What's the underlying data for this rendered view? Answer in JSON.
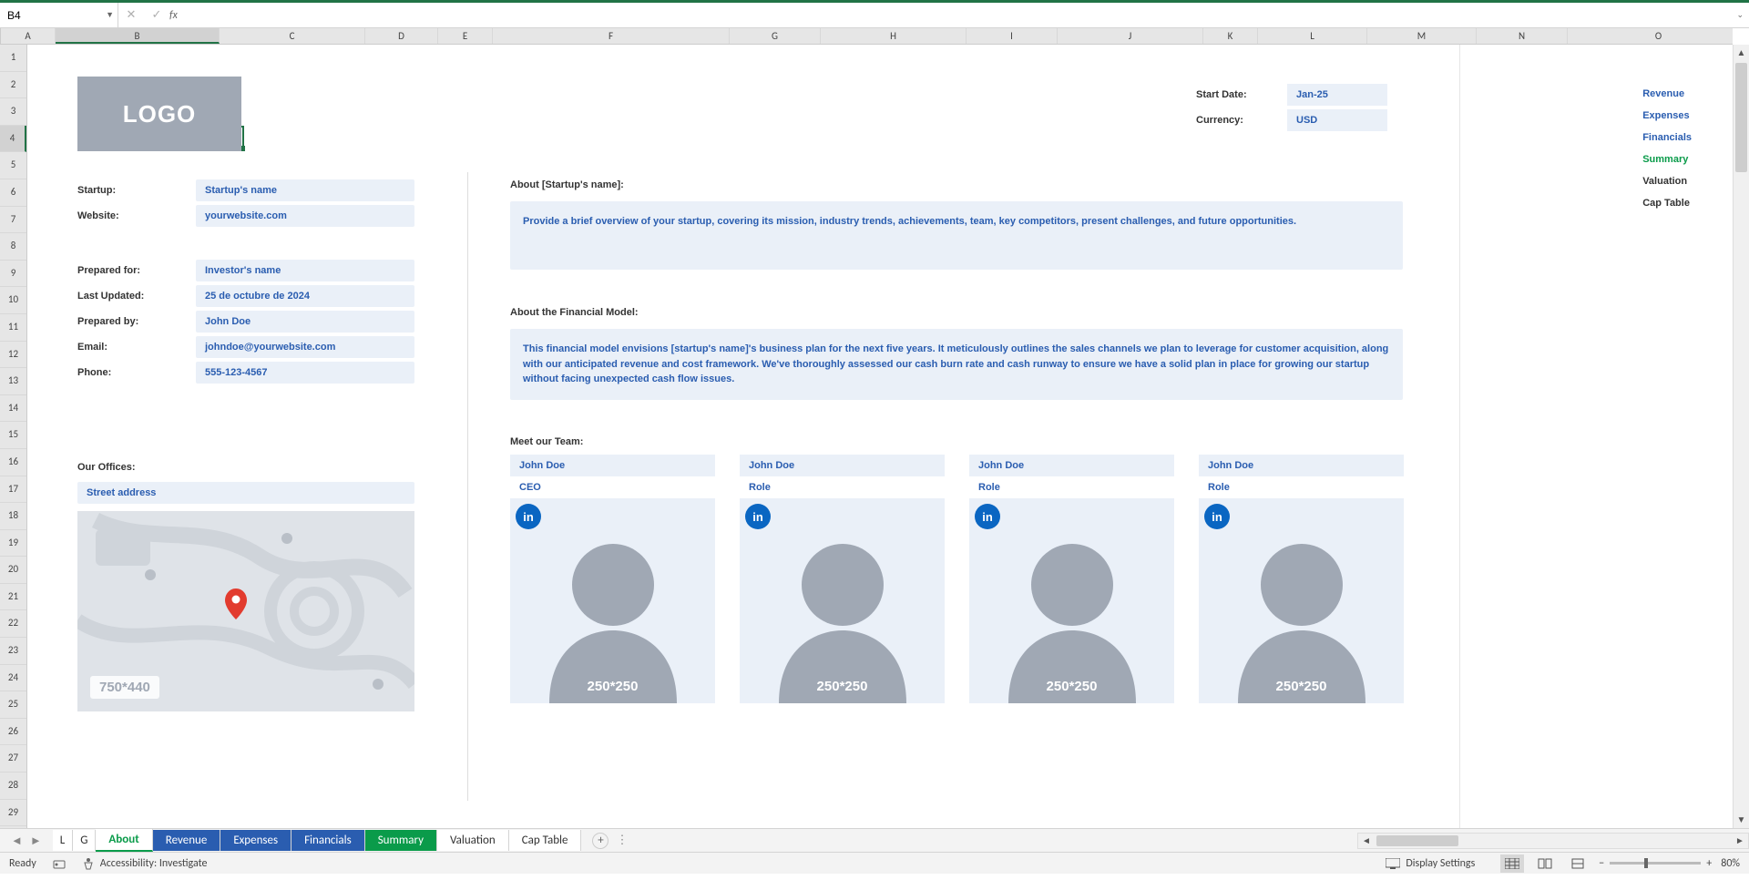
{
  "name_box": "B4",
  "columns": {
    "A": 60,
    "B": 180,
    "C": 160,
    "D": 80,
    "E": 60,
    "F": 260,
    "G": 100,
    "H": 160,
    "I": 100,
    "J": 160,
    "K": 60,
    "L": 120,
    "M": 120,
    "N": 100,
    "O": 200
  },
  "row_count": 29,
  "selected": {
    "col": "B",
    "row": 4
  },
  "logo_text": "LOGO",
  "header_right": [
    {
      "label": "Start Date:",
      "value": "Jan-25"
    },
    {
      "label": "Currency:",
      "value": "USD"
    }
  ],
  "nav": [
    {
      "label": "Revenue",
      "cls": "blue"
    },
    {
      "label": "Expenses",
      "cls": "blue"
    },
    {
      "label": "Financials",
      "cls": "blue"
    },
    {
      "label": "Summary",
      "cls": "green"
    },
    {
      "label": "Valuation",
      "cls": "black"
    },
    {
      "label": "Cap Table",
      "cls": "black"
    }
  ],
  "details_top": [
    {
      "label": "Startup:",
      "value": "Startup's name"
    },
    {
      "label": "Website:",
      "value": "yourwebsite.com"
    }
  ],
  "details_mid": [
    {
      "label": "Prepared for:",
      "value": "Investor's name"
    },
    {
      "label": "Last Updated:",
      "value": "25 de octubre de 2024"
    },
    {
      "label": "Prepared by:",
      "value": "John Doe"
    },
    {
      "label": "Email:",
      "value": "johndoe@yourwebsite.com"
    },
    {
      "label": "Phone:",
      "value": "555-123-4567"
    }
  ],
  "about_startup_heading": "About [Startup's name]:",
  "about_startup_text": "Provide a brief overview of your startup, covering its mission, industry trends, achievements, team, key competitors, present challenges, and future opportunities.",
  "about_model_heading": "About the Financial Model:",
  "about_model_text": "This financial model envisions [startup's name]'s business plan for the next five years. It meticulously outlines the sales channels we plan to leverage for customer acquisition, along with our anticipated revenue and cost framework. We've thoroughly assessed our cash burn rate and cash runway to ensure we have a solid plan in place for growing our startup without facing unexpected cash flow issues.",
  "team_heading": "Meet our Team:",
  "team": [
    {
      "name": "John Doe",
      "role": "CEO",
      "dims": "250*250"
    },
    {
      "name": "John Doe",
      "role": "Role",
      "dims": "250*250"
    },
    {
      "name": "John Doe",
      "role": "Role",
      "dims": "250*250"
    },
    {
      "name": "John Doe",
      "role": "Role",
      "dims": "250*250"
    }
  ],
  "offices_heading": "Our Offices:",
  "offices_address": "Street address",
  "map_dims": "750*440",
  "sheet_tabs": {
    "mini": [
      "L",
      "G"
    ],
    "active": "About",
    "blue": [
      "Revenue",
      "Expenses",
      "Financials"
    ],
    "green": [
      "Summary"
    ],
    "plain": [
      "Valuation",
      "Cap Table"
    ]
  },
  "status": {
    "ready": "Ready",
    "accessibility": "Accessibility: Investigate",
    "display_settings": "Display Settings",
    "zoom": "80%"
  }
}
